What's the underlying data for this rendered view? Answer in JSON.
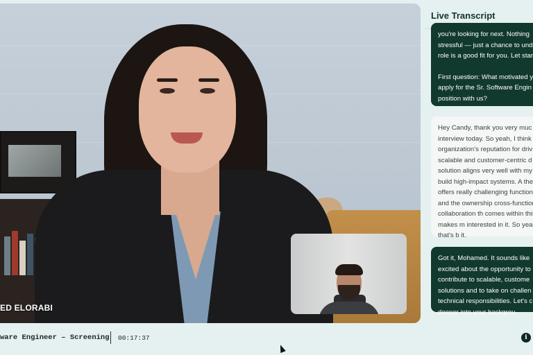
{
  "video": {
    "participant_name": "ED ELORABI"
  },
  "transcript": {
    "title": "Live Transcript",
    "messages": [
      {
        "speaker": "interviewer",
        "paragraphs": [
          "you're looking for next. Nothing stressful — just a chance to und the role is a good fit for you. Let started.",
          "First question: What motivated y apply for the Sr. Software Engin position with us?"
        ]
      },
      {
        "speaker": "candidate",
        "paragraphs": [
          "Hey Candy, thank you very muc interview today. So yeah, I think organization's reputation for driv scalable and customer-centric d solution aligns very well with my to build high-impact systems. A the role offers really challenging functionality and the ownership cross-functional collaboration th comes within this role makes m interested in it. So yeah, that's b it."
        ]
      },
      {
        "speaker": "interviewer",
        "paragraphs": [
          "Got it, Mohamed. It sounds like excited about the opportunity to contribute to scalable, custome solutions and to take on challen technical responsibilities. Let's c deeper into your backgrou"
        ]
      }
    ]
  },
  "bottom_bar": {
    "session_title": "ware Engineer – Screening",
    "timer": "00:17:37",
    "info_label": "i"
  }
}
